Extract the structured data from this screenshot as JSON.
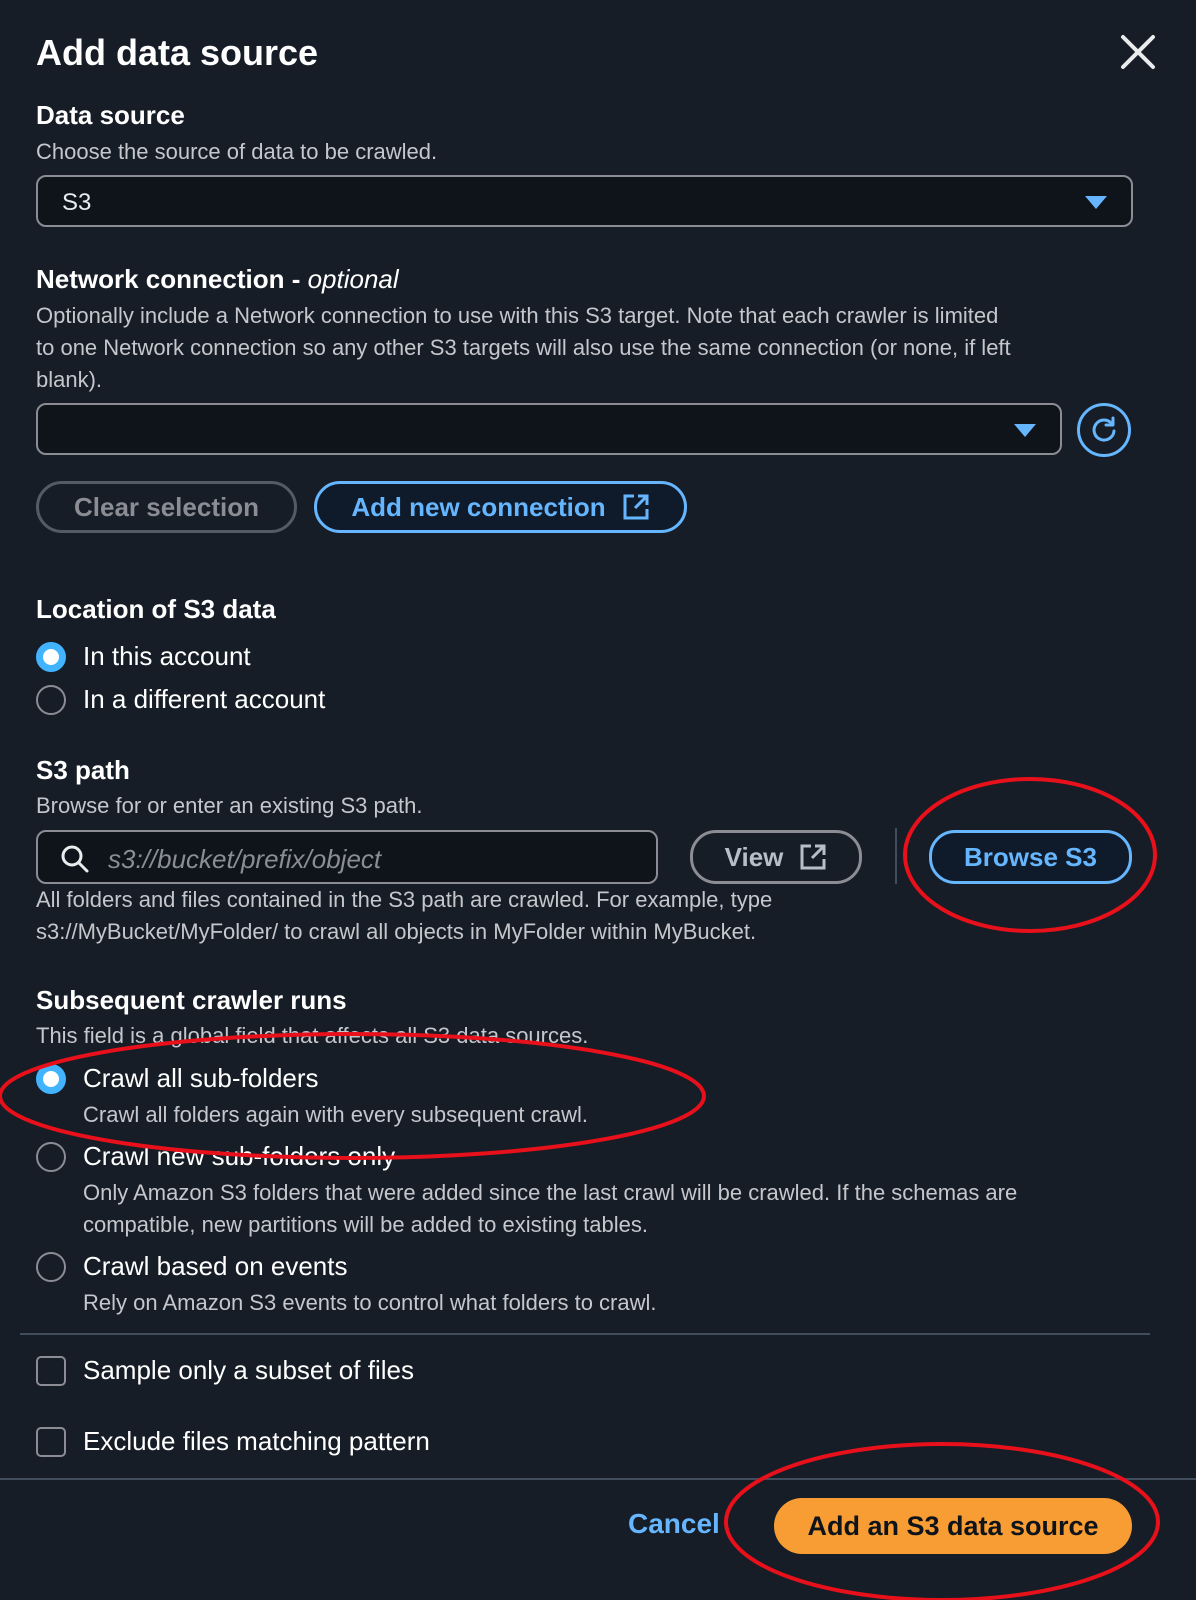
{
  "modal": {
    "title": "Add data source",
    "close_icon": "close-icon"
  },
  "data_source": {
    "label": "Data source",
    "description": "Choose the source of data to be crawled.",
    "selected": "S3"
  },
  "network": {
    "label": "Network connection - ",
    "label_suffix": "optional",
    "description_lines": [
      "Optionally include a Network connection to use with this S3 target. Note that each crawler is limited",
      "to one Network connection so any other S3 targets will also use the same connection (or none, if left",
      "blank)."
    ],
    "selected": "",
    "clear_label": "Clear selection",
    "add_label": "Add new connection"
  },
  "location": {
    "label": "Location of S3 data",
    "options": [
      "In this account",
      "In a different account"
    ],
    "selected_index": 0
  },
  "s3_path": {
    "label": "S3 path",
    "description": "Browse for or enter an existing S3 path.",
    "placeholder": "s3://bucket/prefix/object",
    "view_label": "View",
    "browse_label": "Browse S3",
    "help_lines": [
      "All folders and files contained in the S3 path are crawled. For example, type",
      "s3://MyBucket/MyFolder/ to crawl all objects in MyFolder within MyBucket."
    ]
  },
  "subsequent": {
    "label": "Subsequent crawler runs",
    "description": "This field is a global field that affects all S3 data sources.",
    "options": [
      {
        "label": "Crawl all sub-folders",
        "desc": [
          "Crawl all folders again with every subsequent crawl."
        ]
      },
      {
        "label": "Crawl new sub-folders only",
        "desc": [
          "Only Amazon S3 folders that were added since the last crawl will be crawled. If the schemas are",
          "compatible, new partitions will be added to existing tables."
        ]
      },
      {
        "label": "Crawl based on events",
        "desc": [
          "Rely on Amazon S3 events to control what folders to crawl."
        ]
      }
    ],
    "selected_index": 0
  },
  "checkboxes": [
    {
      "label": "Sample only a subset of files",
      "checked": false
    },
    {
      "label": "Exclude files matching pattern",
      "checked": false
    }
  ],
  "footer": {
    "cancel_label": "Cancel",
    "submit_label": "Add an S3 data source"
  },
  "colors": {
    "accent": "#66b6ff",
    "primary_button": "#f79d33",
    "annotation": "#e8101a"
  }
}
